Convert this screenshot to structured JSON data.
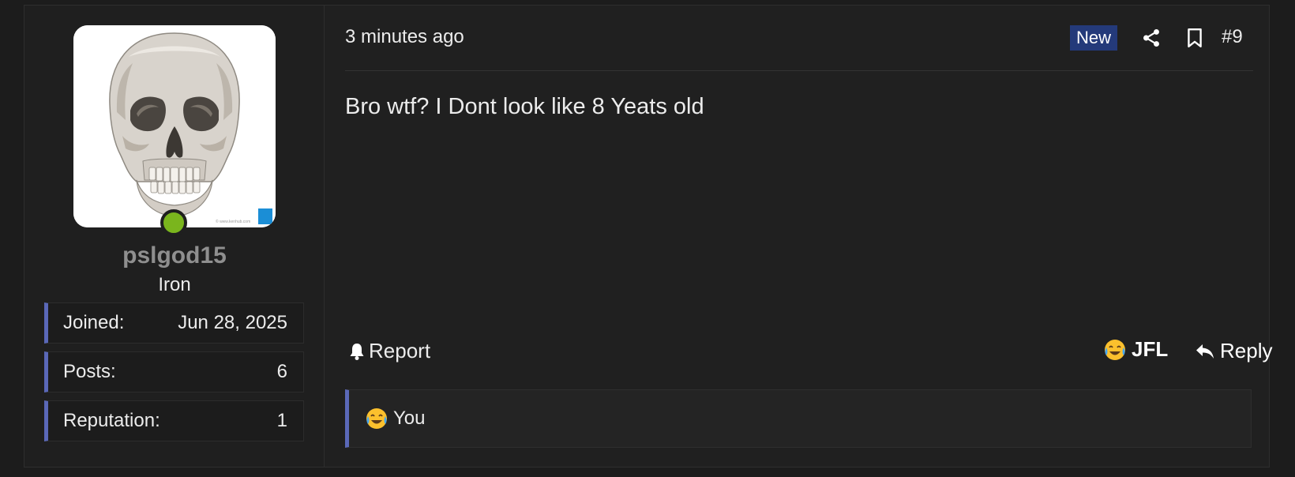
{
  "user": {
    "avatar_icon": "skull-avatar-image",
    "online_status_color": "#7ab51d",
    "username": "pslgod15",
    "title": "Iron",
    "stats": [
      {
        "label": "Joined:",
        "value": "Jun 28, 2025"
      },
      {
        "label": "Posts:",
        "value": "6"
      },
      {
        "label": "Reputation:",
        "value": "1"
      }
    ]
  },
  "post": {
    "timestamp": "3 minutes ago",
    "new_badge": "New",
    "share_icon": "share-icon",
    "bookmark_icon": "bookmark-icon",
    "number": "#9",
    "message": "Bro wtf? I Dont look like 8 Yeats old"
  },
  "actions": {
    "report_label": "Report",
    "reaction_emoji": "face-with-tears-of-joy",
    "reaction_label": "JFL",
    "reply_label": "Reply"
  },
  "reactions_summary": {
    "emoji": "face-with-tears-of-joy",
    "text": "You"
  },
  "colors": {
    "accent": "#5a68b8",
    "new_badge_bg": "#243a7a",
    "background": "#1c1c1c",
    "panel": "#202020"
  }
}
